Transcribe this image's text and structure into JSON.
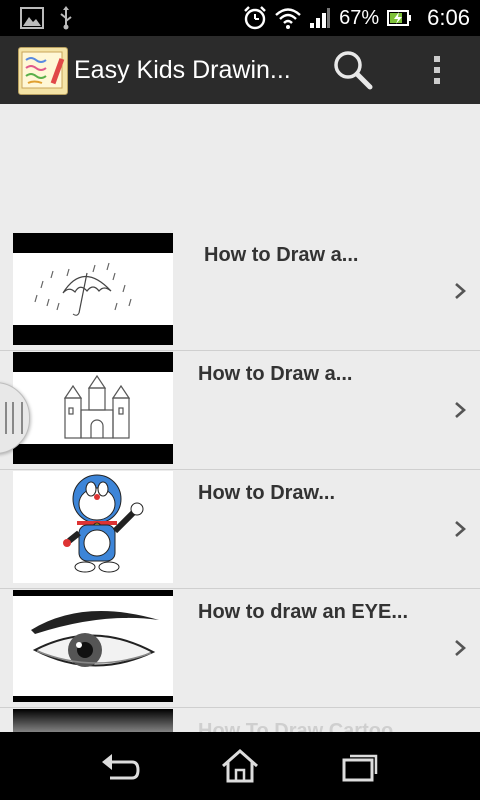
{
  "status_bar": {
    "battery_text": "67%",
    "time": "6:06"
  },
  "action_bar": {
    "title": "Easy Kids Drawin...",
    "icons": [
      "app-icon",
      "search-icon",
      "overflow-menu-icon"
    ]
  },
  "list": {
    "items": [
      {
        "title": "How to Draw a...",
        "thumb": "umbrella-rain"
      },
      {
        "title": "How to Draw a...",
        "thumb": "castle"
      },
      {
        "title": "How to Draw...",
        "thumb": "doraemon"
      },
      {
        "title": "How to draw an EYE...",
        "thumb": "eye"
      },
      {
        "title": "How To Draw Cartoo",
        "thumb": "partial"
      }
    ]
  },
  "nav_bar": {
    "icons": [
      "back-icon",
      "home-icon",
      "recent-apps-icon"
    ]
  },
  "colors": {
    "status_bg": "#000000",
    "actionbar_bg": "#2b2b2b",
    "list_bg": "#ececec",
    "title_text": "#333333"
  }
}
